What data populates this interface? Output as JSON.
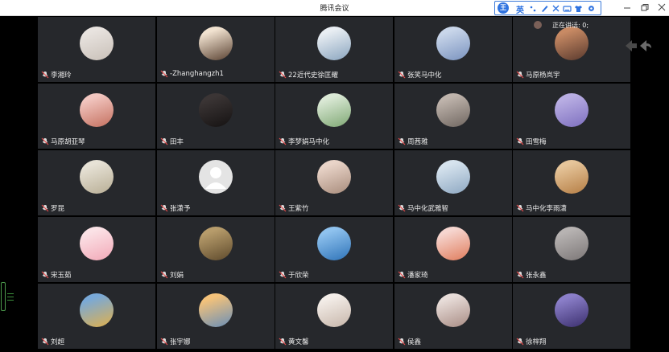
{
  "window": {
    "title": "腾讯会议"
  },
  "ime": {
    "logo": "王",
    "mode": "英"
  },
  "speaking": {
    "label": "正在讲话: 0;"
  },
  "participants": [
    {
      "name": "李湘玲",
      "avatar": "white-cat",
      "colors": [
        "#e8e3df",
        "#c9c0b8"
      ]
    },
    {
      "name": "-Zhanghangzh1",
      "avatar": "child-photo",
      "colors": [
        "#f1e2d0",
        "#5a4232"
      ]
    },
    {
      "name": "22近代史徐匡耀",
      "avatar": "sky-cloud",
      "colors": [
        "#e9eef3",
        "#8aa5bf"
      ]
    },
    {
      "name": "张笑马中化",
      "avatar": "flower-girl",
      "colors": [
        "#c9d6ea",
        "#7a93bf"
      ]
    },
    {
      "name": "马原杨岚宇",
      "avatar": "portrait",
      "colors": [
        "#c88a64",
        "#5a3a2e"
      ]
    },
    {
      "name": "马原胡亚琴",
      "avatar": "woman-portrait",
      "colors": [
        "#f2c6c0",
        "#c4705f"
      ]
    },
    {
      "name": "田丰",
      "avatar": "night-scene",
      "colors": [
        "#3b3535",
        "#151212"
      ]
    },
    {
      "name": "李梦娟马中化",
      "avatar": "green-leaves",
      "colors": [
        "#dbe9d6",
        "#7fa874"
      ]
    },
    {
      "name": "周茜雅",
      "avatar": "gray-cat",
      "colors": [
        "#bfb4ac",
        "#6f6660"
      ]
    },
    {
      "name": "田雪梅",
      "avatar": "cartoon-dog",
      "colors": [
        "#b9aee3",
        "#7d6fbf"
      ]
    },
    {
      "name": "罗昆",
      "avatar": "handwriting",
      "colors": [
        "#e7e2d6",
        "#b8ae95"
      ]
    },
    {
      "name": "张潇予",
      "avatar": "default-person",
      "colors": [
        "#e4e4e4",
        "#c8c8c8"
      ]
    },
    {
      "name": "王紫竹",
      "avatar": "girl-photo",
      "colors": [
        "#e9d4c8",
        "#a88c7c"
      ]
    },
    {
      "name": "马中化武雅智",
      "avatar": "girl-anime",
      "colors": [
        "#d6e3ee",
        "#8ea8c2"
      ]
    },
    {
      "name": "马中化李雨潇",
      "avatar": "shiba-dog",
      "colors": [
        "#e6c59a",
        "#b57e45"
      ]
    },
    {
      "name": "宋玉茹",
      "avatar": "pink-cartoon",
      "colors": [
        "#fbe2e6",
        "#f2a8b7"
      ]
    },
    {
      "name": "刘娟",
      "avatar": "painting",
      "colors": [
        "#b79c6b",
        "#5e4a2c"
      ]
    },
    {
      "name": "于欣荣",
      "avatar": "blue-sky",
      "colors": [
        "#8fc2ee",
        "#2e73b8"
      ]
    },
    {
      "name": "潘家琦",
      "avatar": "cartoon-fox",
      "colors": [
        "#f6d6d0",
        "#e07c5c"
      ]
    },
    {
      "name": "张永鑫",
      "avatar": "gray-landscape",
      "colors": [
        "#b7b3b2",
        "#7c7777"
      ]
    },
    {
      "name": "刘超",
      "avatar": "sunset-field",
      "colors": [
        "#79a9d8",
        "#e0b04c"
      ]
    },
    {
      "name": "张宇娜",
      "avatar": "sunset-sea",
      "colors": [
        "#f4c27a",
        "#6a8fb7"
      ]
    },
    {
      "name": "黄文馨",
      "avatar": "anime-boy",
      "colors": [
        "#f3ede8",
        "#c7b6aa"
      ]
    },
    {
      "name": "侯鑫",
      "avatar": "woman-photo",
      "colors": [
        "#e8ddd9",
        "#a88c84"
      ]
    },
    {
      "name": "徐梓翔",
      "avatar": "purple-moon",
      "colors": [
        "#8b7fc9",
        "#3b2f6e"
      ]
    }
  ]
}
